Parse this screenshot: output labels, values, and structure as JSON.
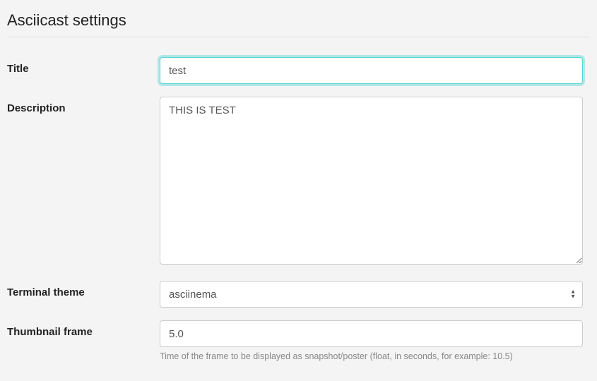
{
  "page": {
    "heading": "Asciicast settings"
  },
  "form": {
    "title": {
      "label": "Title",
      "value": "test"
    },
    "description": {
      "label": "Description",
      "value": "THIS IS TEST"
    },
    "terminal_theme": {
      "label": "Terminal theme",
      "selected": "asciinema"
    },
    "thumbnail_frame": {
      "label": "Thumbnail frame",
      "value": "5.0",
      "help": "Time of the frame to be displayed as snapshot/poster (float, in seconds, for example: 10.5)"
    }
  }
}
